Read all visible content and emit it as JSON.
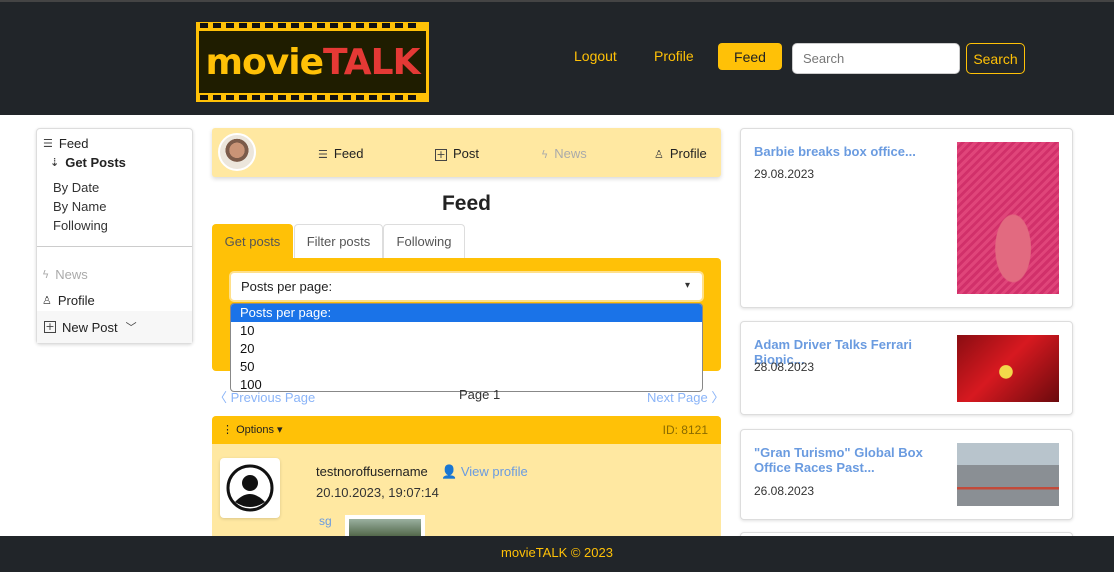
{
  "header": {
    "logo": {
      "part1": "movie",
      "part2": "TALK"
    },
    "nav": {
      "logout": "Logout",
      "profile": "Profile",
      "feed": "Feed"
    },
    "search": {
      "placeholder": "Search",
      "button": "Search"
    }
  },
  "sidebar": {
    "feed": "Feed",
    "get_posts": "Get Posts",
    "sub_items": [
      "By Date",
      "By Name",
      "Following"
    ],
    "news": "News",
    "profile": "Profile",
    "new_post": "New Post"
  },
  "mid_nav": {
    "feed": "Feed",
    "post": "Post",
    "news": "News",
    "profile": "Profile"
  },
  "main": {
    "title": "Feed",
    "tabs": [
      "Get posts",
      "Filter posts",
      "Following"
    ],
    "select": {
      "value": "Posts per page:",
      "options": [
        "Posts per page:",
        "10",
        "20",
        "50",
        "100"
      ]
    },
    "pager": {
      "prev": "Previous Page",
      "page": "Page 1",
      "next": "Next Page"
    }
  },
  "post": {
    "options": "Options",
    "id": "ID: 8121",
    "username": "testnoroffusername",
    "view_profile": "View profile",
    "date": "20.10.2023, 19:07:14",
    "tag": "sg"
  },
  "news": [
    {
      "title": "Barbie breaks box office...",
      "date": "29.08.2023"
    },
    {
      "title": "Adam Driver Talks Ferrari Biopic...",
      "date": "28.08.2023"
    },
    {
      "title": "\"Gran Turismo\" Global Box Office Races Past...",
      "date": "26.08.2023"
    }
  ],
  "footer": "movieTALK © 2023",
  "colors": {
    "brand": "#ffc107",
    "dark": "#212529",
    "panel": "#ffe8a1",
    "link": "#6a9be0"
  }
}
